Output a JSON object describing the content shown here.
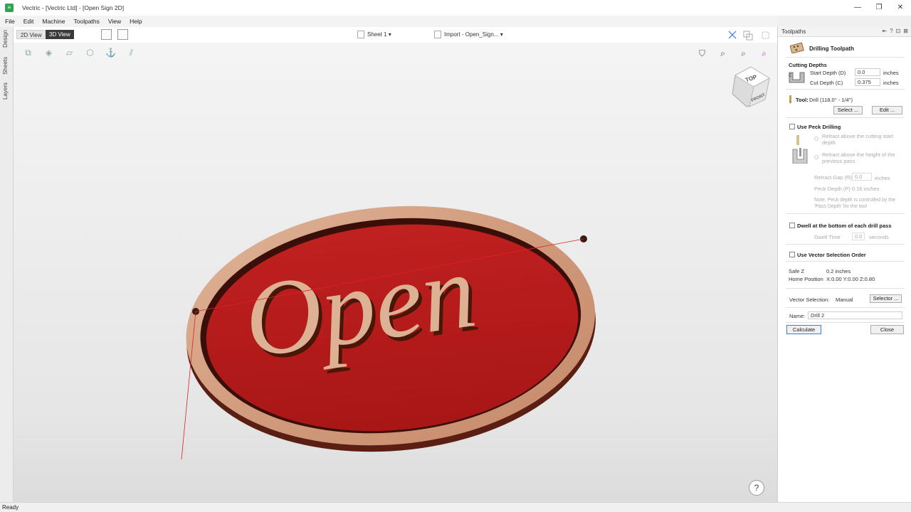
{
  "window": {
    "title": "Vectric - [Vectric Ltd] - [Open Sign 2D]",
    "app_icon": "vectric-logo-icon",
    "controls": [
      "—",
      "❐",
      "✕"
    ]
  },
  "menu": [
    "File",
    "Edit",
    "Machine",
    "Toolpaths",
    "View",
    "Help"
  ],
  "left_tabs": [
    "Design",
    "Sheets",
    "Layers"
  ],
  "view_tabs": {
    "view2d": "2D View",
    "view3d": "3D View"
  },
  "sheet_dropdown": "Sheet 1 ▾",
  "import_dropdown": "Import - Open_Sign... ▾",
  "sign": {
    "text": "Open",
    "board_color": "#b51b1b",
    "wood_color": "#d9a98a"
  },
  "cube": {
    "top": "TOP",
    "front": "FRONT"
  },
  "help": "?",
  "panel": {
    "title": "Toolpaths",
    "header_buttons": [
      "⇤",
      "?",
      "⊡",
      "⊠"
    ],
    "toolpath_name": "Drilling Toolpath",
    "cutting_depths": {
      "heading": "Cutting Depths",
      "start_label": "Start Depth (D)",
      "start_value": "0.0",
      "cut_label": "Cut Depth (C)",
      "cut_value": "0.375",
      "unit": "inches"
    },
    "tool": {
      "label": "Tool:",
      "value": "Drill (118.0° - 1/4\")",
      "select": "Select ...",
      "edit": "Edit ..."
    },
    "peck": {
      "label": "Use Peck Drilling",
      "opt1": "Retract above the cutting start depth",
      "opt2": "Retract above the height of the previous pass",
      "gap_label": "Retract Gap (R)",
      "gap_value": "0.0",
      "gap_unit": "inches",
      "depth_label": "Peck Depth (P)",
      "depth_value": "0.16 inches",
      "note": "Note: Peck depth is controlled by the 'Pass Depth' for the tool"
    },
    "dwell": {
      "label": "Dwell at the bottom of each drill pass",
      "time_label": "Dwell Time",
      "time_value": "0.0",
      "time_unit": "seconds"
    },
    "vector_order": "Use Vector Selection Order",
    "safe_z_label": "Safe Z",
    "safe_z_value": "0.2 inches",
    "home_label": "Home Position",
    "home_value": "X:0.00 Y:0.00 Z:0.80",
    "vector_selection_label": "Vector Selection:",
    "vector_selection_value": "Manual",
    "selector_button": "Selector ...",
    "name_label": "Name:",
    "name_value": "Drill 2",
    "calculate": "Calculate",
    "close": "Close"
  },
  "status": "Ready"
}
